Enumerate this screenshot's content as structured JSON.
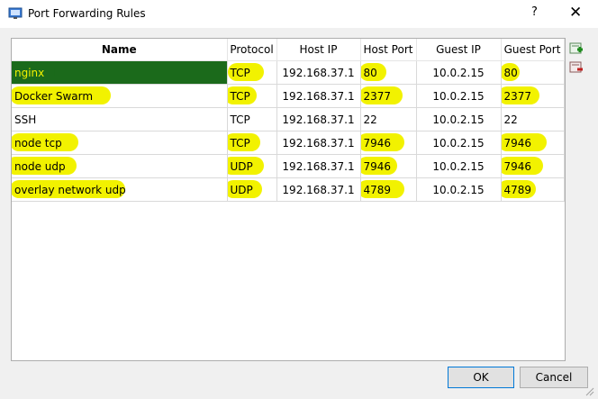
{
  "window": {
    "title": "Port Forwarding Rules",
    "help": "?",
    "close": "✕"
  },
  "columns": [
    "Name",
    "Protocol",
    "Host IP",
    "Host Port",
    "Guest IP",
    "Guest Port"
  ],
  "rows": [
    {
      "name": "nginx",
      "protocol": "TCP",
      "host_ip": "192.168.37.1",
      "host_port": "80",
      "guest_ip": "10.0.2.15",
      "guest_port": "80"
    },
    {
      "name": "Docker Swarm",
      "protocol": "TCP",
      "host_ip": "192.168.37.1",
      "host_port": "2377",
      "guest_ip": "10.0.2.15",
      "guest_port": "2377"
    },
    {
      "name": "SSH",
      "protocol": "TCP",
      "host_ip": "192.168.37.1",
      "host_port": "22",
      "guest_ip": "10.0.2.15",
      "guest_port": "22"
    },
    {
      "name": "node tcp",
      "protocol": "TCP",
      "host_ip": "192.168.37.1",
      "host_port": "7946",
      "guest_ip": "10.0.2.15",
      "guest_port": "7946"
    },
    {
      "name": "node udp",
      "protocol": "UDP",
      "host_ip": "192.168.37.1",
      "host_port": "7946",
      "guest_ip": "10.0.2.15",
      "guest_port": "7946"
    },
    {
      "name": "overlay network udp",
      "protocol": "UDP",
      "host_ip": "192.168.37.1",
      "host_port": "4789",
      "guest_ip": "10.0.2.15",
      "guest_port": "4789"
    }
  ],
  "buttons": {
    "ok": "OK",
    "cancel": "Cancel"
  },
  "colors": {
    "highlight": "#f2f200",
    "selection": "#0078d7"
  },
  "icons": {
    "add": "add-rule-icon",
    "remove": "remove-rule-icon"
  }
}
